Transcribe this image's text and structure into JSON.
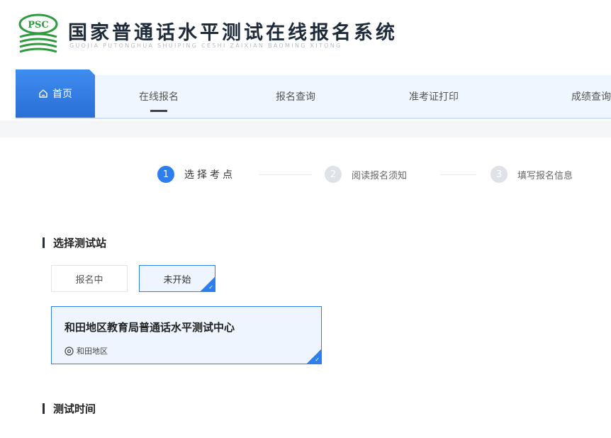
{
  "header": {
    "logo_text": "PSC",
    "title": "国家普通话水平测试在线报名系统",
    "subtitle": "GUOJIA PUTONGHUA SHUIPING CESHI ZAIXIAN BAOMING XITONG"
  },
  "nav": {
    "items": [
      {
        "label": "首页",
        "icon": "home-icon"
      },
      {
        "label": "在线报名"
      },
      {
        "label": "报名查询"
      },
      {
        "label": "准考证打印"
      },
      {
        "label": "成绩查询"
      }
    ],
    "active_index": 1,
    "highlight_index": 0
  },
  "steps": [
    {
      "num": "1",
      "label": "选择考点"
    },
    {
      "num": "2",
      "label": "阅读报名须知"
    },
    {
      "num": "3",
      "label": "填写报名信息"
    }
  ],
  "section_station": {
    "title": "选择测试站",
    "filters": [
      {
        "label": "报名中"
      },
      {
        "label": "未开始"
      }
    ],
    "selected_filter": 1,
    "centers": [
      {
        "name": "和田地区教育局普通话水平测试中心",
        "location": "和田地区",
        "icon": "location-icon"
      }
    ]
  },
  "section_time": {
    "title": "测试时间"
  },
  "colors": {
    "accent": "#2d7ff0",
    "nav_bg": "#f0f6ff",
    "logo_green": "#2f9a3f",
    "title": "#1f2a3a"
  }
}
